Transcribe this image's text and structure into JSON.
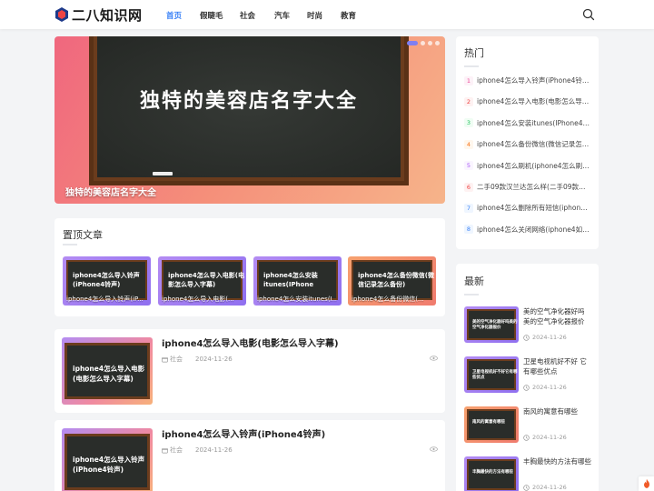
{
  "brand": {
    "logo_text": "二八知识网"
  },
  "nav": {
    "items": [
      {
        "label": "首页",
        "active": true
      },
      {
        "label": "假睫毛",
        "active": false
      },
      {
        "label": "社会",
        "active": false
      },
      {
        "label": "汽车",
        "active": false
      },
      {
        "label": "时尚",
        "active": false
      },
      {
        "label": "教育",
        "active": false
      }
    ]
  },
  "hero": {
    "board_title": "独特的美容店名字大全",
    "caption": "独特的美容店名字大全"
  },
  "sticky": {
    "title": "置顶文章",
    "cards": [
      {
        "board_text": "iphone4怎么导入铃声(iPhone4铃声)",
        "caption": "iphone4怎么导入铃声(iP..."
      },
      {
        "board_text": "iphone4怎么导入电影(电影怎么导入字幕)",
        "caption": "iphone4怎么导入电影(..."
      },
      {
        "board_text": "iphone4怎么安装itunes(IPhone",
        "caption": "iphone4怎么安装itunes(I..."
      },
      {
        "board_text": "iphone4怎么备份微信(微信记录怎么备份)",
        "caption": "iphone4怎么备份微信(..."
      }
    ]
  },
  "articles": [
    {
      "title": "iphone4怎么导入电影(电影怎么导入字幕)",
      "thumb_text": "iphone4怎么导入电影(电影怎么导入字幕)",
      "category": "社会",
      "date": "2024-11-26"
    },
    {
      "title": "iphone4怎么导入铃声(iPhone4铃声)",
      "thumb_text": "iphone4怎么导入铃声(iPhone4铃声)",
      "category": "社会",
      "date": "2024-11-26"
    }
  ],
  "hot": {
    "title": "热门",
    "items": [
      {
        "num": "1",
        "text": "iphone4怎么导入铃声(iPhone4铃声)",
        "color": "#ec4899",
        "bg": "#fdf2f8"
      },
      {
        "num": "2",
        "text": "iphone4怎么导入电影(电影怎么导入...",
        "color": "#ef4444",
        "bg": "#fef2f2"
      },
      {
        "num": "3",
        "text": "iphone4怎么安装itunes(IPhone4怎么...",
        "color": "#22c55e",
        "bg": "#f0fdf4"
      },
      {
        "num": "4",
        "text": "iphone4怎么备份微信(微信记录怎么...",
        "color": "#f97316",
        "bg": "#fff7ed"
      },
      {
        "num": "5",
        "text": "iphone4怎么刷机(iphone4怎么刷机下...",
        "color": "#a855f7",
        "bg": "#faf5ff"
      },
      {
        "num": "6",
        "text": "二手09款汉兰达怎么样(二手09款汉兰...",
        "color": "#ef4444",
        "bg": "#fef2f2"
      },
      {
        "num": "7",
        "text": "iphone4怎么删除所有短信(iphone4怎...",
        "color": "#3b82f6",
        "bg": "#eff6ff"
      },
      {
        "num": "8",
        "text": "iphone4怎么关闭网络(iphone4如何关...",
        "color": "#3b82f6",
        "bg": "#eff6ff"
      }
    ]
  },
  "latest": {
    "title": "最新",
    "items": [
      {
        "title": "美的空气净化器好吗 美的空气净化器报价",
        "thumb_text": "美的空气净化器好吗美的空气净化器报价",
        "date": "2024-11-26"
      },
      {
        "title": "卫星电视机好不好 它有哪些优点",
        "thumb_text": "卫星电视机好不好它有哪些优点",
        "date": "2024-11-26"
      },
      {
        "title": "南风的寓意有哪些",
        "thumb_text": "南风的寓意有哪些",
        "date": "2024-11-26"
      },
      {
        "title": "丰胸最快的方法有哪些",
        "thumb_text": "丰胸最快的方法有哪些",
        "date": "2024-11-26"
      }
    ]
  }
}
